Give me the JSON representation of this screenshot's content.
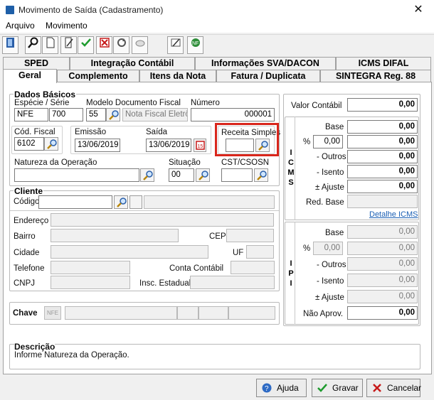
{
  "window": {
    "title": "Movimento de Saída (Cadastramento)",
    "close": "✕"
  },
  "menu": [
    "Arquivo",
    "Movimento"
  ],
  "toolbar": [
    "book-icon",
    "search-icon",
    "new-doc-icon",
    "edit-icon",
    "confirm-icon",
    "delete-icon",
    "refresh-icon",
    "mail-icon",
    "iss-icon",
    "nfe-icon"
  ],
  "tabs_row1": [
    "SPED",
    "Integração Contábil",
    "Informações SVA/DACON",
    "ICMS DIFAL"
  ],
  "tabs_row2": [
    "Geral",
    "Complemento",
    "Itens da Nota",
    "Fatura / Duplicata",
    "SINTEGRA Reg. 88"
  ],
  "dados": {
    "title": "Dados Básicos",
    "especie_serie_label": "Espécie  /  Série",
    "especie": "NFE",
    "serie": "700",
    "modelo_label": "Modelo Documento Fiscal",
    "modelo": "55",
    "modelo_desc": "Nota Fiscal Eletrôn",
    "numero_label": "Número",
    "numero": "000001",
    "cfop_label": "Cód. Fiscal",
    "cfop": "6102",
    "emissao_label": "Emissão",
    "emissao": "13/06/2019",
    "saida_label": "Saída",
    "saida": "13/06/2019",
    "receita_label": "Receita Simples",
    "receita": "",
    "natureza_label": "Natureza da Operação",
    "natureza": "",
    "situacao_label": "Situação",
    "situacao": "00",
    "cst_label": "CST/CSOSN",
    "cst": ""
  },
  "cliente": {
    "title": "Cliente",
    "codigo_label": "Código",
    "endereco_label": "Endereço",
    "bairro_label": "Bairro",
    "cep_label": "CEP",
    "cidade_label": "Cidade",
    "uf_label": "UF",
    "telefone_label": "Telefone",
    "conta_label": "Conta Contábil",
    "cnpj_label": "CNPJ",
    "ie_label": "Insc. Estadual"
  },
  "chave": {
    "label": "Chave",
    "nfe": "NFE"
  },
  "totais": {
    "valor_contabil_label": "Valor Contábil",
    "valor_contabil": "0,00",
    "icms_vert": "I\nC\nM\nS",
    "icms": {
      "base_label": "Base",
      "base": "0,00",
      "pct_label": "%",
      "pct": "0,00",
      "valor": "0,00",
      "outros_label": "- Outros",
      "outros": "0,00",
      "isento_label": "- Isento",
      "isento": "0,00",
      "ajuste_label": "± Ajuste",
      "ajuste": "0,00",
      "red_label": "Red. Base",
      "red": "",
      "detalhe_link": "Detalhe ICMS"
    },
    "ipi_vert": "I\nP\nI",
    "ipi": {
      "base_label": "Base",
      "base": "0,00",
      "pct_label": "%",
      "pct": "0,00",
      "valor": "0,00",
      "outros_label": "- Outros",
      "outros": "0,00",
      "isento_label": "- Isento",
      "isento": "0,00",
      "ajuste_label": "± Ajuste",
      "ajuste": "0,00",
      "naoaprov_label": "Não Aprov.",
      "naoaprov": "0,00"
    }
  },
  "descricao": {
    "title": "Descrição",
    "text": "Informe Natureza da Operação."
  },
  "buttons": {
    "ajuda": "Ajuda",
    "gravar": "Gravar",
    "cancelar": "Cancelar"
  }
}
